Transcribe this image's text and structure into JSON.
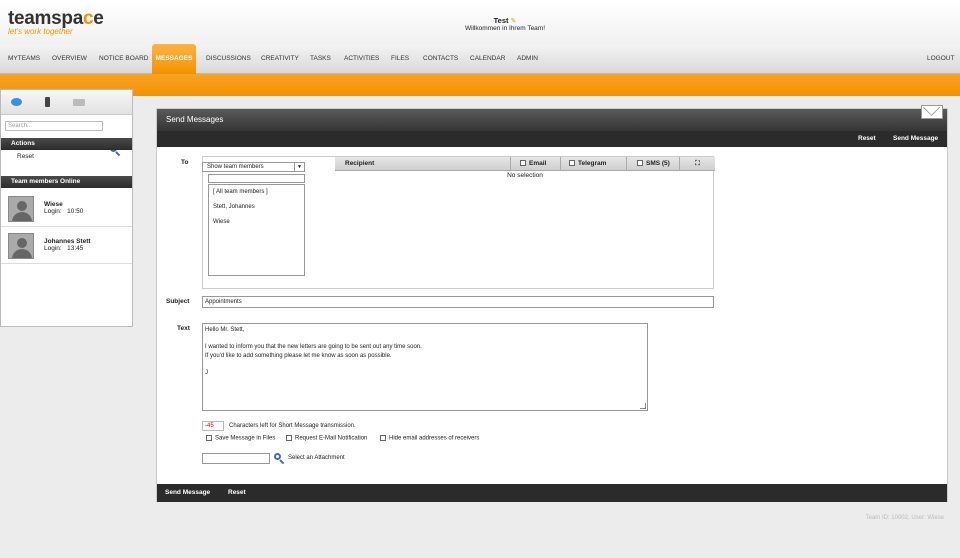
{
  "logo": {
    "text_main": "teamspa",
    "text_c": "c",
    "text_end": "e",
    "tagline": "let's work together"
  },
  "header": {
    "user": "Test",
    "welcome": "Willkommen in Ihrem Team!"
  },
  "nav": {
    "items": [
      "MYTEAMS",
      "OVERVIEW",
      "NOTICE BOARD",
      "MESSAGES",
      "DISCUSSIONS",
      "CREATIVITY",
      "TASKS",
      "ACTIVITIES",
      "FILES",
      "CONTACTS",
      "CALENDAR",
      "ADMIN"
    ],
    "active": "MESSAGES",
    "logout": "LOGOUT"
  },
  "sidebar": {
    "search_placeholder": "Search...",
    "actions_header": "Actions",
    "reset": "Reset",
    "online_header": "Team members Online",
    "members": [
      {
        "name": "Wiese",
        "login_label": "Login:",
        "time": "10:50"
      },
      {
        "name": "Johannes Stett",
        "login_label": "Login:",
        "time": "13:45"
      }
    ]
  },
  "main": {
    "title": "Send Messages",
    "top_reset": "Reset",
    "top_send": "Send Message",
    "to_label": "To",
    "select_value": "Show team members",
    "members_list": [
      "[ All team members ]",
      "Stett, Johannes",
      "Wiese"
    ],
    "recipient_header": "Recipient",
    "col_email": "Email",
    "col_telegram": "Telegram",
    "col_sms": "SMS (5)",
    "no_selection": "No selection",
    "subject_label": "Subject",
    "subject_value": "Appointments",
    "text_label": "Text",
    "text_lines": [
      "Hello Mr. Stett,",
      "",
      "I wanted to inform you that the new letters are going to be sent out any time soon.",
      "If you'd like to add something please let me know as soon as possible.",
      "",
      "J"
    ],
    "chars_left": "-45",
    "chars_label": "Characters left for Short Message transmission.",
    "opt_save": "Save Message in Files",
    "opt_request": "Request E-Mail Notification",
    "opt_hide": "Hide email addresses of receivers",
    "attach_label": "Select an Attachment",
    "bottom_send": "Send Message",
    "bottom_reset": "Reset"
  },
  "footer": {
    "info": "Team ID: 10002, User: Wiese"
  },
  "colors": {
    "accent": "#f39200",
    "dark_bar": "#2b2b2b"
  }
}
